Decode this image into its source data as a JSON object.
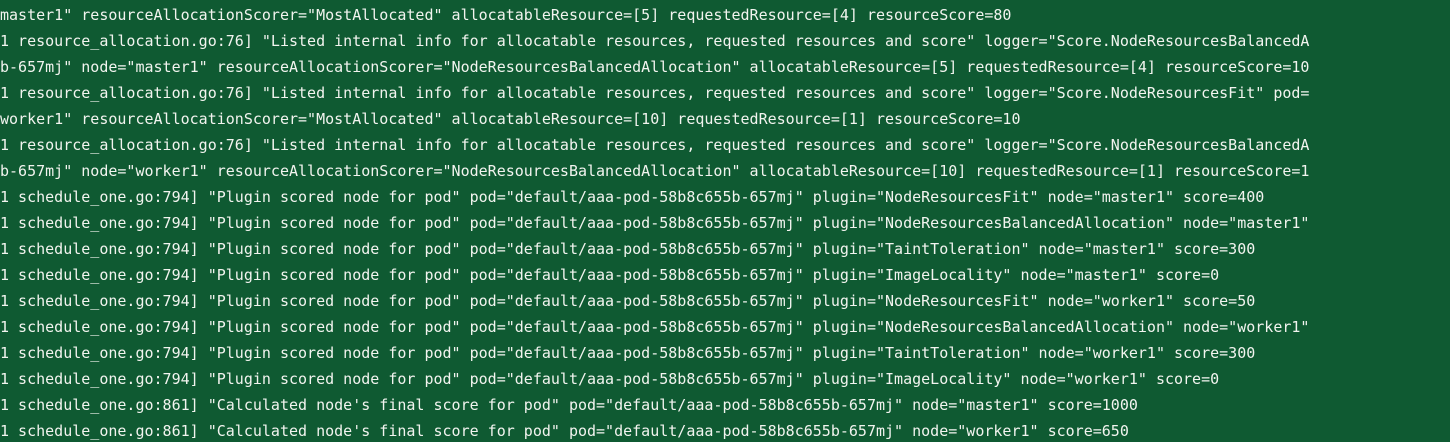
{
  "terminal": {
    "lines": [
      "master1\" resourceAllocationScorer=\"MostAllocated\" allocatableResource=[5] requestedResource=[4] resourceScore=80",
      "1 resource_allocation.go:76] \"Listed internal info for allocatable resources, requested resources and score\" logger=\"Score.NodeResourcesBalancedA",
      "b-657mj\" node=\"master1\" resourceAllocationScorer=\"NodeResourcesBalancedAllocation\" allocatableResource=[5] requestedResource=[4] resourceScore=10",
      "1 resource_allocation.go:76] \"Listed internal info for allocatable resources, requested resources and score\" logger=\"Score.NodeResourcesFit\" pod=",
      "worker1\" resourceAllocationScorer=\"MostAllocated\" allocatableResource=[10] requestedResource=[1] resourceScore=10",
      "1 resource_allocation.go:76] \"Listed internal info for allocatable resources, requested resources and score\" logger=\"Score.NodeResourcesBalancedA",
      "b-657mj\" node=\"worker1\" resourceAllocationScorer=\"NodeResourcesBalancedAllocation\" allocatableResource=[10] requestedResource=[1] resourceScore=1",
      "1 schedule_one.go:794] \"Plugin scored node for pod\" pod=\"default/aaa-pod-58b8c655b-657mj\" plugin=\"NodeResourcesFit\" node=\"master1\" score=400",
      "1 schedule_one.go:794] \"Plugin scored node for pod\" pod=\"default/aaa-pod-58b8c655b-657mj\" plugin=\"NodeResourcesBalancedAllocation\" node=\"master1\"",
      "1 schedule_one.go:794] \"Plugin scored node for pod\" pod=\"default/aaa-pod-58b8c655b-657mj\" plugin=\"TaintToleration\" node=\"master1\" score=300",
      "1 schedule_one.go:794] \"Plugin scored node for pod\" pod=\"default/aaa-pod-58b8c655b-657mj\" plugin=\"ImageLocality\" node=\"master1\" score=0",
      "1 schedule_one.go:794] \"Plugin scored node for pod\" pod=\"default/aaa-pod-58b8c655b-657mj\" plugin=\"NodeResourcesFit\" node=\"worker1\" score=50",
      "1 schedule_one.go:794] \"Plugin scored node for pod\" pod=\"default/aaa-pod-58b8c655b-657mj\" plugin=\"NodeResourcesBalancedAllocation\" node=\"worker1\"",
      "1 schedule_one.go:794] \"Plugin scored node for pod\" pod=\"default/aaa-pod-58b8c655b-657mj\" plugin=\"TaintToleration\" node=\"worker1\" score=300",
      "1 schedule_one.go:794] \"Plugin scored node for pod\" pod=\"default/aaa-pod-58b8c655b-657mj\" plugin=\"ImageLocality\" node=\"worker1\" score=0",
      "1 schedule_one.go:861] \"Calculated node's final score for pod\" pod=\"default/aaa-pod-58b8c655b-657mj\" node=\"master1\" score=1000",
      "1 schedule_one.go:861] \"Calculated node's final score for pod\" pod=\"default/aaa-pod-58b8c655b-657mj\" node=\"worker1\" score=650"
    ],
    "colors": {
      "background": "#0f5a32",
      "text": "#f2f4ef"
    }
  }
}
